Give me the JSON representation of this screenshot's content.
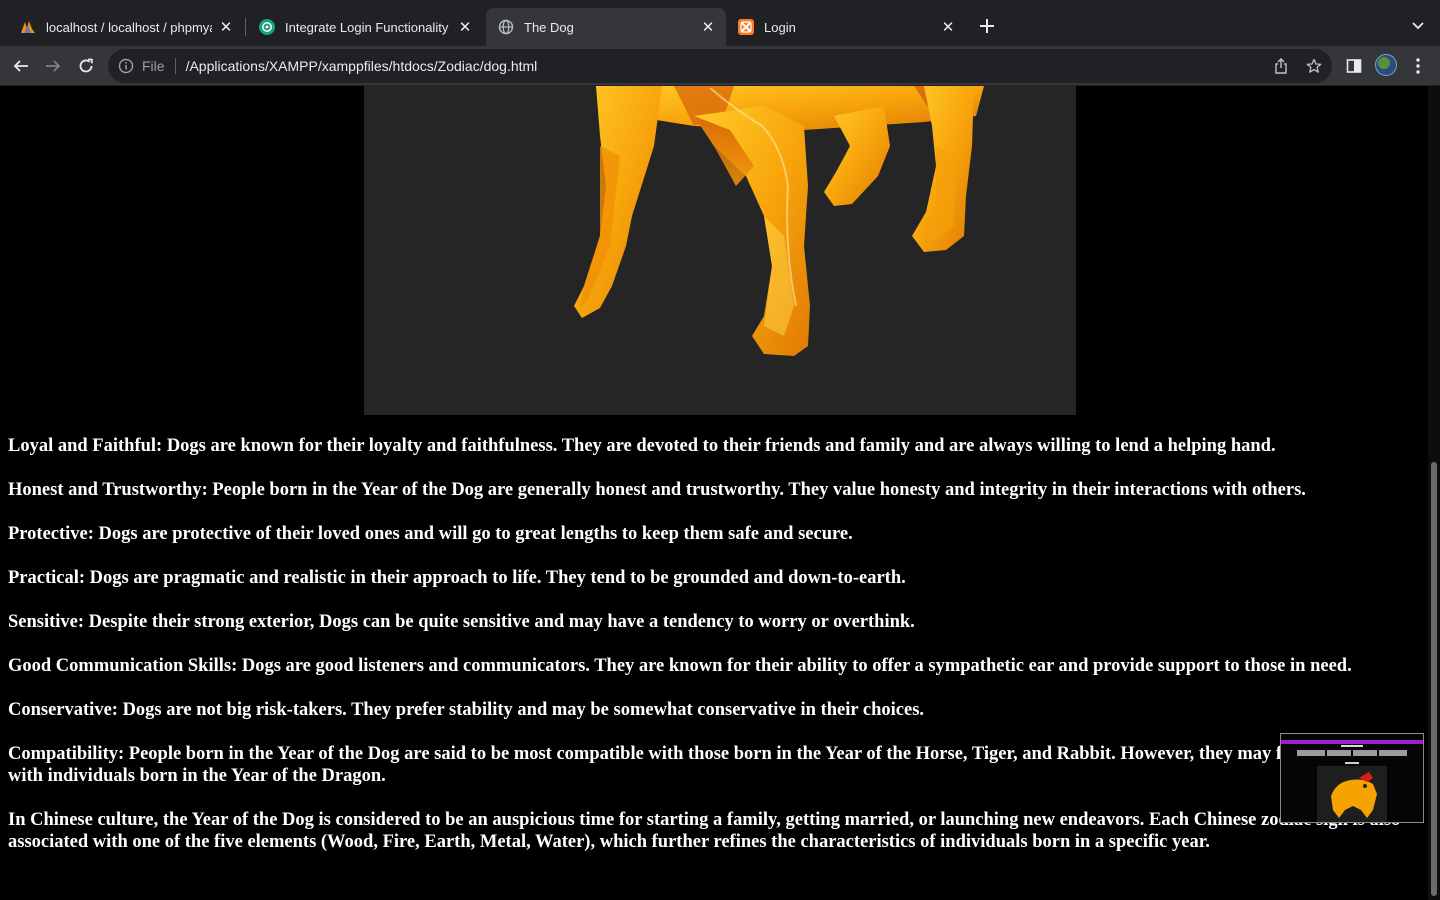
{
  "browser": {
    "tabs": [
      {
        "title": "localhost / localhost / phpmyadmin",
        "icon": "phpmyadmin-icon",
        "active": false
      },
      {
        "title": "Integrate Login Functionality",
        "icon": "chatgpt-icon",
        "active": false
      },
      {
        "title": "The Dog",
        "icon": "globe-icon",
        "active": true
      },
      {
        "title": "Login",
        "icon": "xampp-icon",
        "active": false
      }
    ],
    "address_bar": {
      "scheme_label": "File",
      "url": "/Applications/XAMPP/xamppfiles/htdocs/Zodiac/dog.html"
    }
  },
  "page": {
    "background": "#000000",
    "text_color": "#ffffff",
    "paragraphs": [
      "Loyal and Faithful: Dogs are known for their loyalty and faithfulness. They are devoted to their friends and family and are always willing to lend a helping hand.",
      "Honest and Trustworthy: People born in the Year of the Dog are generally honest and trustworthy. They value honesty and integrity in their interactions with others.",
      "Protective: Dogs are protective of their loved ones and will go to great lengths to keep them safe and secure.",
      "Practical: Dogs are pragmatic and realistic in their approach to life. They tend to be grounded and down-to-earth.",
      "Sensitive: Despite their strong exterior, Dogs can be quite sensitive and may have a tendency to worry or overthink.",
      "Good Communication Skills: Dogs are good listeners and communicators. They are known for their ability to offer a sympathetic ear and provide support to those in need.",
      "Conservative: Dogs are not big risk-takers. They prefer stability and may be somewhat conservative in their choices.",
      "Compatibility: People born in the Year of the Dog are said to be most compatible with those born in the Year of the Horse, Tiger, and Rabbit. However, they may face challenges with individuals born in the Year of the Dragon.",
      "In Chinese culture, the Year of the Dog is considered to be an auspicious time for starting a family, getting married, or launching new endeavors. Each Chinese zodiac sign is also associated with one of the five elements (Wood, Fire, Earth, Metal, Water), which further refines the characteristics of individuals born in a specific year."
    ]
  },
  "colors": {
    "tab_strip": "#202124",
    "active_tab": "#35363a",
    "omnibox": "#202124",
    "dog_orange": "#f5a300",
    "image_bg": "#252525"
  }
}
